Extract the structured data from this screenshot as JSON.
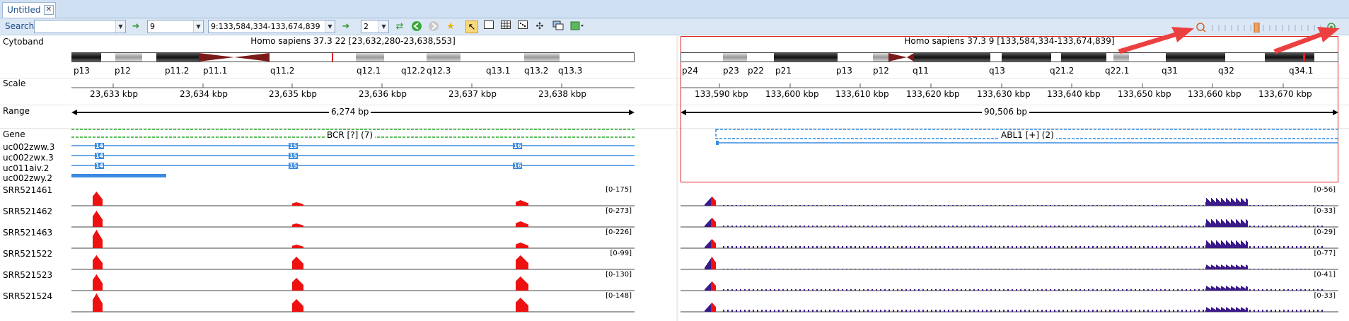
{
  "tab": {
    "label": "Untitled",
    "close": "✕"
  },
  "toolbar": {
    "search_label": "Search",
    "search_value": "",
    "chromosome": "9",
    "location": "9:133,584,334-133,674,839",
    "panels": "2",
    "icons": [
      "go-arrow-icon",
      "go-arrow-icon",
      "refresh-icon",
      "back-icon",
      "forward-icon",
      "bookmark-icon",
      "select-tool-icon",
      "single-panel-icon",
      "grid-icon",
      "dots-icon",
      "network-icon",
      "window-icon",
      "export-icon",
      "zoom-out-icon",
      "zoom-in-icon"
    ]
  },
  "track_labels": {
    "cytoband": "Cytoband",
    "scale": "Scale",
    "range": "Range",
    "gene": "Gene",
    "transcripts": [
      "uc002zww.3",
      "uc002zwx.3",
      "uc011aiv.2",
      "uc002zwy.2"
    ],
    "samples": [
      "SRR521461",
      "SRR521462",
      "SRR521463",
      "SRR521522",
      "SRR521523",
      "SRR521524"
    ]
  },
  "left_panel": {
    "header": "Homo sapiens 37.3 22 [23,632,280-23,638,553]",
    "bands": [
      "p13",
      "p12",
      "p11.2",
      "p11.1",
      "q11.2",
      "q12.1",
      "q12.2",
      "q12.3",
      "q13.1",
      "q13.2",
      "q13.3"
    ],
    "scale": [
      "23,633 kbp",
      "23,634 kbp",
      "23,635 kbp",
      "23,636 kbp",
      "23,637 kbp",
      "23,638 kbp"
    ],
    "range": "6,274 bp",
    "gene": "BCR [?] (7)",
    "exons": [
      "14",
      "15",
      "16"
    ],
    "ranges": [
      "[0-175]",
      "[0-273]",
      "[0-226]",
      "[0-99]",
      "[0-130]",
      "[0-148]"
    ]
  },
  "right_panel": {
    "header": "Homo sapiens 37.3 9 [133,584,334-133,674,839]",
    "bands": [
      "p24",
      "p23",
      "p22",
      "p21",
      "p13",
      "p12",
      "q11",
      "q13",
      "q21.2",
      "q22.1",
      "q31",
      "q32",
      "q34.1"
    ],
    "scale": [
      "133,590 kbp",
      "133,600 kbp",
      "133,610 kbp",
      "133,620 kbp",
      "133,630 kbp",
      "133,640 kbp",
      "133,650 kbp",
      "133,660 kbp",
      "133,670 kbp"
    ],
    "range": "90,506 bp",
    "gene": "ABL1 [+] (2)",
    "ranges": [
      "[0-56]",
      "[0-33]",
      "[0-29]",
      "[0-77]",
      "[0-41]",
      "[0-33]"
    ]
  },
  "colors": {
    "accent": "#e02020",
    "coverage": "#ee1111",
    "gene_left": "#22aa22",
    "gene_right": "#2d8be0",
    "coverage_right": "#3b1a8a",
    "selection": "#e02020",
    "arrow": "#ec4040"
  }
}
